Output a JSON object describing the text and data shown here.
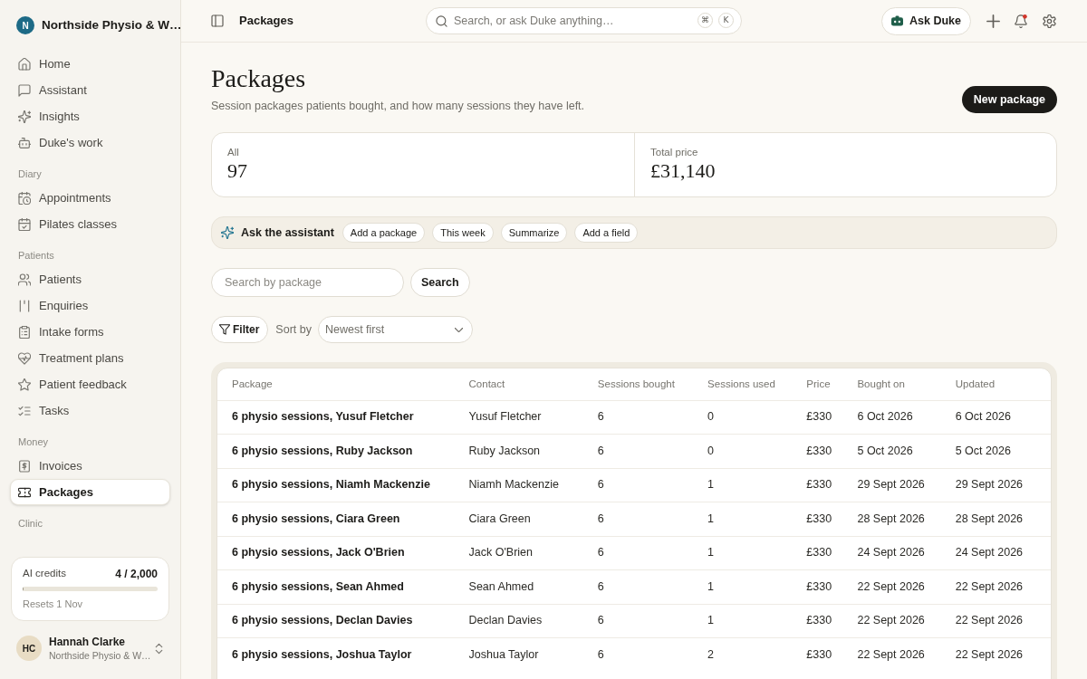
{
  "sidebar": {
    "workspace": {
      "initial": "N",
      "name": "Northside Physio & W…"
    },
    "sections": [
      {
        "items": [
          {
            "label": "Home",
            "selected": false
          },
          {
            "label": "Assistant",
            "selected": false
          },
          {
            "label": "Insights",
            "selected": false
          },
          {
            "label": "Duke's work",
            "selected": false
          }
        ]
      },
      {
        "label": "Diary",
        "items": [
          {
            "label": "Appointments",
            "selected": false
          },
          {
            "label": "Pilates classes",
            "selected": false
          }
        ]
      },
      {
        "label": "Patients",
        "items": [
          {
            "label": "Patients",
            "selected": false
          },
          {
            "label": "Enquiries",
            "selected": false
          },
          {
            "label": "Intake forms",
            "selected": false
          },
          {
            "label": "Treatment plans",
            "selected": false
          },
          {
            "label": "Patient feedback",
            "selected": false
          },
          {
            "label": "Tasks",
            "selected": false
          }
        ]
      },
      {
        "label": "Money",
        "items": [
          {
            "label": "Invoices",
            "selected": false
          },
          {
            "label": "Packages",
            "selected": true
          }
        ]
      },
      {
        "label": "Clinic"
      }
    ],
    "credits": {
      "label": "AI credits",
      "value": "4 / 2,000",
      "level": 0.002,
      "note": "Resets 1 Nov"
    },
    "user": {
      "initials": "HC",
      "name": "Hannah Clarke",
      "workspace": "Northside Physio & W…"
    }
  },
  "topbar": {
    "title": "Packages",
    "search": {
      "placeholder": "Search, or ask Duke anything…",
      "shortcut": [
        "⌘",
        "K"
      ]
    },
    "ask_button": "Ask Duke",
    "notifications_unread": true
  },
  "page": {
    "title": "Packages",
    "subtitle": "Session packages patients bought, and how many sessions they have left.",
    "new_button": "New package"
  },
  "stats": [
    {
      "label": "All",
      "value": "97"
    },
    {
      "label": "Total price",
      "value": "£31,140"
    }
  ],
  "assistant": {
    "label": "Ask the assistant",
    "suggestions": [
      "Add a package",
      "This week",
      "Summarize",
      "Add a field"
    ]
  },
  "search": {
    "placeholder": "Search by package",
    "button": "Search"
  },
  "filter": {
    "button": "Filter",
    "sort_label": "Sort by",
    "sort_value": "Newest first"
  },
  "table": {
    "columns": [
      "Package",
      "Contact",
      "Sessions bought",
      "Sessions used",
      "Price",
      "Bought on",
      "Updated"
    ],
    "rows": [
      [
        "6 physio sessions, Yusuf Fletcher",
        "Yusuf Fletcher",
        "6",
        "0",
        "£330",
        "6 Oct 2026",
        "6 Oct 2026"
      ],
      [
        "6 physio sessions, Ruby Jackson",
        "Ruby Jackson",
        "6",
        "0",
        "£330",
        "5 Oct 2026",
        "5 Oct 2026"
      ],
      [
        "6 physio sessions, Niamh Mackenzie",
        "Niamh Mackenzie",
        "6",
        "1",
        "£330",
        "29 Sept 2026",
        "29 Sept 2026"
      ],
      [
        "6 physio sessions, Ciara Green",
        "Ciara Green",
        "6",
        "1",
        "£330",
        "28 Sept 2026",
        "28 Sept 2026"
      ],
      [
        "6 physio sessions, Jack O'Brien",
        "Jack O'Brien",
        "6",
        "1",
        "£330",
        "24 Sept 2026",
        "24 Sept 2026"
      ],
      [
        "6 physio sessions, Sean Ahmed",
        "Sean Ahmed",
        "6",
        "1",
        "£330",
        "22 Sept 2026",
        "22 Sept 2026"
      ],
      [
        "6 physio sessions, Declan Davies",
        "Declan Davies",
        "6",
        "1",
        "£330",
        "22 Sept 2026",
        "22 Sept 2026"
      ],
      [
        "6 physio sessions, Joshua Taylor",
        "Joshua Taylor",
        "6",
        "2",
        "£330",
        "22 Sept 2026",
        "22 Sept 2026"
      ]
    ]
  }
}
